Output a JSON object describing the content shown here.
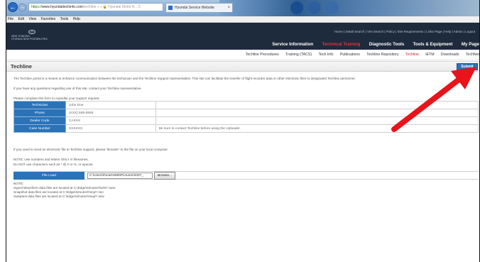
{
  "browser": {
    "back_glyph": "←",
    "forward_glyph": "→",
    "url_prefix": "https://",
    "url_host": "www.hyundaitechinfo.com",
    "url_rest": "/techline",
    "url_tail": " ⌕ ▾ 🔒 Hyundai Motor A... C",
    "tab_title": "Hyundai Service Website",
    "tab_close": "×"
  },
  "menu": [
    "File",
    "Edit",
    "View",
    "Favorites",
    "Tools",
    "Help"
  ],
  "header": {
    "logo_line1": "NEW THINKING.",
    "logo_line2": "HYUNDAI NEW POSSIBILITIES.",
    "utility_links": "Home | Detail Search | VIN Search | Policy | Site Requirements | Links Page | Help | Admin | Logout",
    "main_nav": [
      {
        "label": "Service Information",
        "active": false
      },
      {
        "label": "Technical Training",
        "active": true
      },
      {
        "label": "Diagnostic Tools",
        "active": false
      },
      {
        "label": "Tools & Equipment",
        "active": false
      },
      {
        "label": "My Page",
        "active": false
      }
    ]
  },
  "subnav": [
    {
      "label": "Techline Procedures",
      "active": false
    },
    {
      "label": "Training (TACS)",
      "active": false
    },
    {
      "label": "Tech Info",
      "active": false
    },
    {
      "label": "Publications",
      "active": false
    },
    {
      "label": "Techline Repository",
      "active": false
    },
    {
      "label": "Techline",
      "active": true
    },
    {
      "label": "iETM",
      "active": false
    },
    {
      "label": "Downloads",
      "active": false
    },
    {
      "label": "TechNet",
      "active": false
    }
  ],
  "page": {
    "title": "Techline",
    "submit_label": "Submit",
    "intro": "The Techline portal is a means to enhance communication between the technician and the Techline Support representative. This site can facilitate the transfer of flight recorder data or other electronic files to designated Techline personnel.",
    "questions": "If you have any questions regarding use of this site, contact your Techline representative.",
    "complete_form": "Please complete this form to expedite your support request.",
    "fields": [
      {
        "label": "Technician",
        "value": "John Doe",
        "note": ""
      },
      {
        "label": "Phone",
        "value": "(XXX) 555-5555",
        "note": ""
      },
      {
        "label": "Dealer Code",
        "value": "CAXXX",
        "note": ""
      },
      {
        "label": "Case Number",
        "value": "XXXXXX",
        "note": "Be sure to contact Techline before using the Uploader."
      }
    ],
    "send_file": "If you need to send an electronic file to Techline support, please \"Browse\" to the file on your local computer.",
    "note_letters": "NOTE: Use numbers and letters ONLY in filenames.",
    "note_chars": "Do NOT use characters such as * @ # or %, or spaces.",
    "file_label": "File Load",
    "file_value": "C:\\Users\\hma01895\\Pictures\\2007_",
    "browse_label": "Browse...",
    "note_head": "NOTE:",
    "note_lines": [
      "Signal Waveform data files are located at C:\\Edge\\Simutech\\wfv\\*.sww",
      "Snapshot data files are located at C:\\Edge\\Simutech\\snp\\*.ssn",
      "Sweptest data files are located at C:\\Edge\\Simutech\\swp\\*.ssw"
    ]
  },
  "colors": {
    "header_bg": "#1e2b3c",
    "active_red": "#e8303a",
    "label_blue": "#2b73b8",
    "arrow_red": "#e8131b"
  }
}
